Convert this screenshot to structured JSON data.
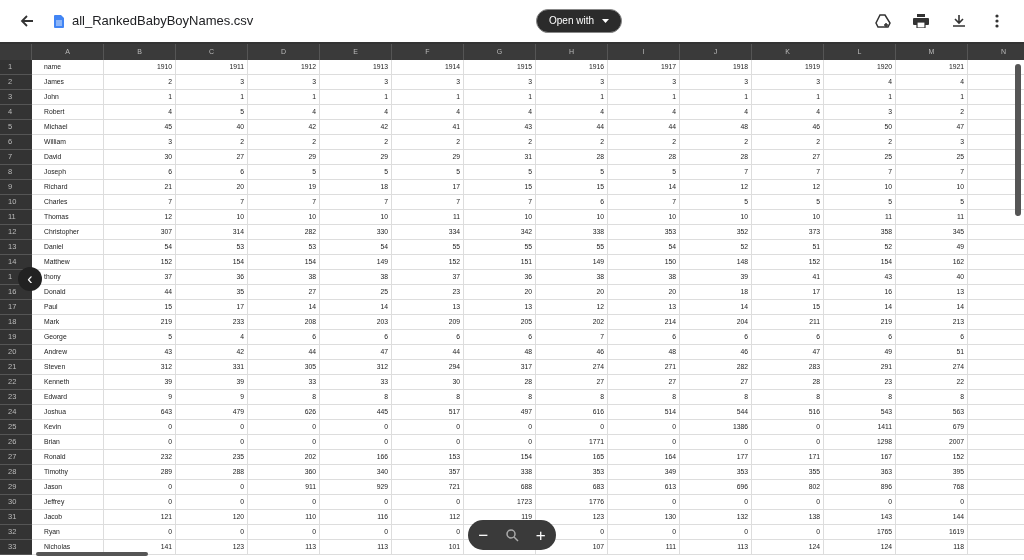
{
  "window": {
    "title": "all_RankedBabyBoyNames.csv",
    "open_with": "Open with"
  },
  "sheet": {
    "columns": [
      "A",
      "B",
      "C",
      "D",
      "E",
      "F",
      "G",
      "H",
      "I",
      "J",
      "K",
      "L",
      "M",
      "N"
    ],
    "rows": [
      {
        "number": "1",
        "cells": [
          "name",
          "1910",
          "1911",
          "1912",
          "1913",
          "1914",
          "1915",
          "1916",
          "1917",
          "1918",
          "1919",
          "1920",
          "1921"
        ]
      },
      {
        "number": "2",
        "cells": [
          "James",
          "2",
          "3",
          "3",
          "3",
          "3",
          "3",
          "3",
          "3",
          "3",
          "3",
          "4",
          "4"
        ]
      },
      {
        "number": "3",
        "cells": [
          "John",
          "1",
          "1",
          "1",
          "1",
          "1",
          "1",
          "1",
          "1",
          "1",
          "1",
          "1",
          "1"
        ]
      },
      {
        "number": "4",
        "cells": [
          "Robert",
          "4",
          "5",
          "4",
          "4",
          "4",
          "4",
          "4",
          "4",
          "4",
          "4",
          "3",
          "2"
        ]
      },
      {
        "number": "5",
        "cells": [
          "Michael",
          "45",
          "40",
          "42",
          "42",
          "41",
          "43",
          "44",
          "44",
          "48",
          "46",
          "50",
          "47"
        ]
      },
      {
        "number": "6",
        "cells": [
          "William",
          "3",
          "2",
          "2",
          "2",
          "2",
          "2",
          "2",
          "2",
          "2",
          "2",
          "2",
          "3"
        ]
      },
      {
        "number": "7",
        "cells": [
          "David",
          "30",
          "27",
          "29",
          "29",
          "29",
          "31",
          "28",
          "28",
          "28",
          "27",
          "25",
          "25"
        ]
      },
      {
        "number": "8",
        "cells": [
          "Joseph",
          "6",
          "6",
          "5",
          "5",
          "5",
          "5",
          "5",
          "5",
          "7",
          "7",
          "7",
          "7"
        ]
      },
      {
        "number": "9",
        "cells": [
          "Richard",
          "21",
          "20",
          "19",
          "18",
          "17",
          "15",
          "15",
          "14",
          "12",
          "12",
          "10",
          "10"
        ]
      },
      {
        "number": "10",
        "cells": [
          "Charles",
          "7",
          "7",
          "7",
          "7",
          "7",
          "7",
          "6",
          "7",
          "5",
          "5",
          "5",
          "5"
        ]
      },
      {
        "number": "11",
        "cells": [
          "Thomas",
          "12",
          "10",
          "10",
          "10",
          "11",
          "10",
          "10",
          "10",
          "10",
          "10",
          "11",
          "11"
        ]
      },
      {
        "number": "12",
        "cells": [
          "Christopher",
          "307",
          "314",
          "282",
          "330",
          "334",
          "342",
          "338",
          "353",
          "352",
          "373",
          "358",
          "345"
        ]
      },
      {
        "number": "13",
        "cells": [
          "Daniel",
          "54",
          "53",
          "53",
          "54",
          "55",
          "55",
          "55",
          "54",
          "52",
          "51",
          "52",
          "49"
        ]
      },
      {
        "number": "14",
        "cells": [
          "Matthew",
          "152",
          "154",
          "154",
          "149",
          "152",
          "151",
          "149",
          "150",
          "148",
          "152",
          "154",
          "162"
        ]
      },
      {
        "number": "1",
        "cells": [
          "thony",
          "37",
          "36",
          "38",
          "38",
          "37",
          "36",
          "38",
          "38",
          "39",
          "41",
          "43",
          "40"
        ]
      },
      {
        "number": "16",
        "cells": [
          "Donald",
          "44",
          "35",
          "27",
          "25",
          "23",
          "20",
          "20",
          "20",
          "18",
          "17",
          "16",
          "13"
        ]
      },
      {
        "number": "17",
        "cells": [
          "Paul",
          "15",
          "17",
          "14",
          "14",
          "13",
          "13",
          "12",
          "13",
          "14",
          "15",
          "14",
          "14"
        ]
      },
      {
        "number": "18",
        "cells": [
          "Mark",
          "219",
          "233",
          "208",
          "203",
          "209",
          "205",
          "202",
          "214",
          "204",
          "211",
          "219",
          "213"
        ]
      },
      {
        "number": "19",
        "cells": [
          "George",
          "5",
          "4",
          "6",
          "6",
          "6",
          "6",
          "7",
          "6",
          "6",
          "6",
          "6",
          "6"
        ]
      },
      {
        "number": "20",
        "cells": [
          "Andrew",
          "43",
          "42",
          "44",
          "47",
          "44",
          "48",
          "46",
          "48",
          "46",
          "47",
          "49",
          "51"
        ]
      },
      {
        "number": "21",
        "cells": [
          "Steven",
          "312",
          "331",
          "305",
          "312",
          "294",
          "317",
          "274",
          "271",
          "282",
          "283",
          "291",
          "274"
        ]
      },
      {
        "number": "22",
        "cells": [
          "Kenneth",
          "39",
          "39",
          "33",
          "33",
          "30",
          "28",
          "27",
          "27",
          "27",
          "28",
          "23",
          "22"
        ]
      },
      {
        "number": "23",
        "cells": [
          "Edward",
          "9",
          "9",
          "8",
          "8",
          "8",
          "8",
          "8",
          "8",
          "8",
          "8",
          "8",
          "8"
        ]
      },
      {
        "number": "24",
        "cells": [
          "Joshua",
          "643",
          "479",
          "626",
          "445",
          "517",
          "497",
          "616",
          "514",
          "544",
          "516",
          "543",
          "563"
        ]
      },
      {
        "number": "25",
        "cells": [
          "Kevin",
          "0",
          "0",
          "0",
          "0",
          "0",
          "0",
          "0",
          "0",
          "1386",
          "0",
          "1411",
          "679"
        ]
      },
      {
        "number": "26",
        "cells": [
          "Brian",
          "0",
          "0",
          "0",
          "0",
          "0",
          "0",
          "1771",
          "0",
          "0",
          "0",
          "1298",
          "2007"
        ]
      },
      {
        "number": "27",
        "cells": [
          "Ronald",
          "232",
          "235",
          "202",
          "166",
          "153",
          "154",
          "165",
          "164",
          "177",
          "171",
          "167",
          "152"
        ]
      },
      {
        "number": "28",
        "cells": [
          "Timothy",
          "289",
          "288",
          "360",
          "340",
          "357",
          "338",
          "353",
          "349",
          "353",
          "355",
          "363",
          "395"
        ]
      },
      {
        "number": "29",
        "cells": [
          "Jason",
          "0",
          "0",
          "911",
          "929",
          "721",
          "688",
          "683",
          "613",
          "696",
          "802",
          "896",
          "768"
        ]
      },
      {
        "number": "30",
        "cells": [
          "Jeffrey",
          "0",
          "0",
          "0",
          "0",
          "0",
          "1723",
          "1776",
          "0",
          "0",
          "0",
          "0",
          "0"
        ]
      },
      {
        "number": "31",
        "cells": [
          "Jacob",
          "121",
          "120",
          "110",
          "116",
          "112",
          "119",
          "123",
          "130",
          "132",
          "138",
          "143",
          "144"
        ]
      },
      {
        "number": "32",
        "cells": [
          "Ryan",
          "0",
          "0",
          "0",
          "0",
          "0",
          null,
          "0",
          "0",
          "0",
          "0",
          "1765",
          "1619"
        ]
      },
      {
        "number": "33",
        "cells": [
          "Nicholas",
          "141",
          "123",
          "113",
          "113",
          "101",
          null,
          "107",
          "111",
          "113",
          "124",
          "124",
          "118"
        ]
      }
    ]
  },
  "zoom_controls": {
    "minus": "−",
    "plus": "+"
  },
  "back_overlay": "‹"
}
